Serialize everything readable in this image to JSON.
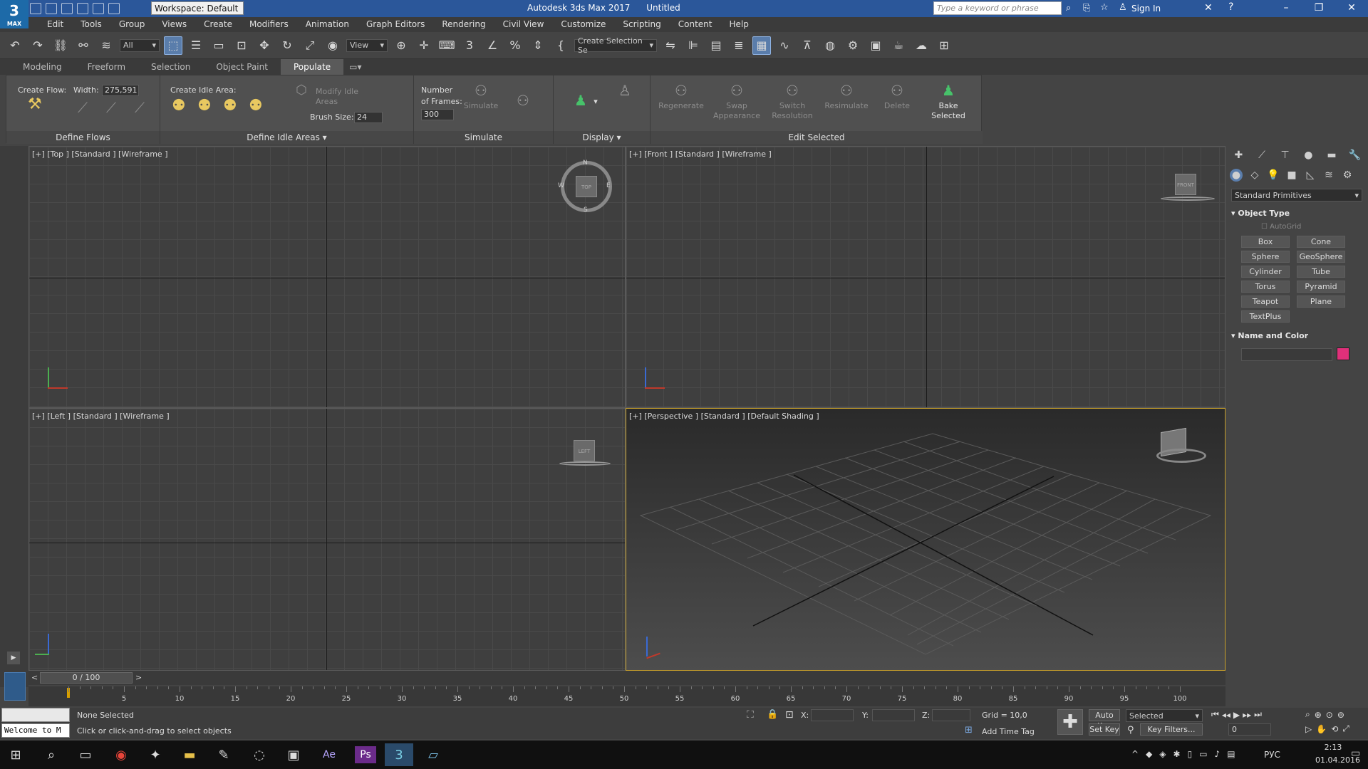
{
  "titlebar": {
    "app_title": "Autodesk 3ds Max 2017",
    "document": "Untitled",
    "workspace": "Workspace: Default",
    "search_placeholder": "Type a keyword or phrase",
    "sign_in": "Sign In",
    "logo": "3",
    "logo_sub": "MAX",
    "bg_color": "#2b579a"
  },
  "menu": [
    "Edit",
    "Tools",
    "Group",
    "Views",
    "Create",
    "Modifiers",
    "Animation",
    "Graph Editors",
    "Rendering",
    "Civil View",
    "Customize",
    "Scripting",
    "Content",
    "Help"
  ],
  "toolbar": {
    "filter": "All",
    "ref_coord": "View",
    "selection_set": "Create Selection Se"
  },
  "ribbon_tabs": [
    "Modeling",
    "Freeform",
    "Selection",
    "Object Paint",
    "Populate"
  ],
  "ribbon_active_tab": "Populate",
  "ribbon": {
    "create_flow": "Create Flow:",
    "width_label": "Width:",
    "width_value": "275,591",
    "create_idle": "Create Idle Area:",
    "modify_idle": "Modify Idle Areas",
    "brush_size_label": "Brush Size:",
    "brush_size_value": "24",
    "frames_label_1": "Number",
    "frames_label_2": "of Frames:",
    "frames_value": "300",
    "simulate": "Simulate",
    "regenerate": "Regenerate",
    "swap": "Swap Appearance",
    "switch_res": "Switch Resolution",
    "resimulate": "Resimulate",
    "delete": "Delete",
    "bake": "Bake Selected",
    "panels": {
      "define_flows": "Define Flows",
      "define_idle": "Define Idle Areas",
      "simulate": "Simulate",
      "display": "Display",
      "edit_selected": "Edit Selected"
    }
  },
  "viewports": {
    "top": "[+] [Top ] [Standard ] [Wireframe ]",
    "front": "[+] [Front ] [Standard ] [Wireframe ]",
    "left": "[+] [Left ] [Standard ] [Wireframe ]",
    "persp": "[+] [Perspective ] [Standard ] [Default Shading ]",
    "cube_top": "TOP",
    "cube_front": "FRONT",
    "cube_left": "LEFT",
    "compass": {
      "n": "N",
      "s": "S",
      "e": "E",
      "w": "W"
    },
    "active_border": "#c8a02a"
  },
  "command_panel": {
    "category": "Standard Primitives",
    "object_type_title": "Object Type",
    "autogrid": "AutoGrid",
    "primitives": [
      "Box",
      "Cone",
      "Sphere",
      "GeoSphere",
      "Cylinder",
      "Tube",
      "Torus",
      "Pyramid",
      "Teapot",
      "Plane",
      "TextPlus"
    ],
    "name_color_title": "Name and Color",
    "color_swatch": "#e0307a"
  },
  "timeline": {
    "frame_counter": "0 / 100",
    "ticks": [
      "5",
      "10",
      "15",
      "20",
      "25",
      "30",
      "35",
      "40",
      "45",
      "50",
      "55",
      "60",
      "65",
      "70",
      "75",
      "80",
      "85",
      "90",
      "95",
      "100"
    ]
  },
  "status": {
    "maxscript": "Welcome to M",
    "selection": "None Selected",
    "prompt": "Click or click-and-drag to select objects",
    "x_label": "X:",
    "y_label": "Y:",
    "z_label": "Z:",
    "grid": "Grid = 10,0",
    "add_time_tag": "Add Time Tag",
    "auto_key": "Auto Key",
    "set_key": "Set Key",
    "key_mode": "Selected",
    "key_filters": "Key Filters...",
    "current_frame": "0"
  },
  "taskbar": {
    "lang": "РУС",
    "time": "2:13",
    "date": "01.04.2016"
  }
}
